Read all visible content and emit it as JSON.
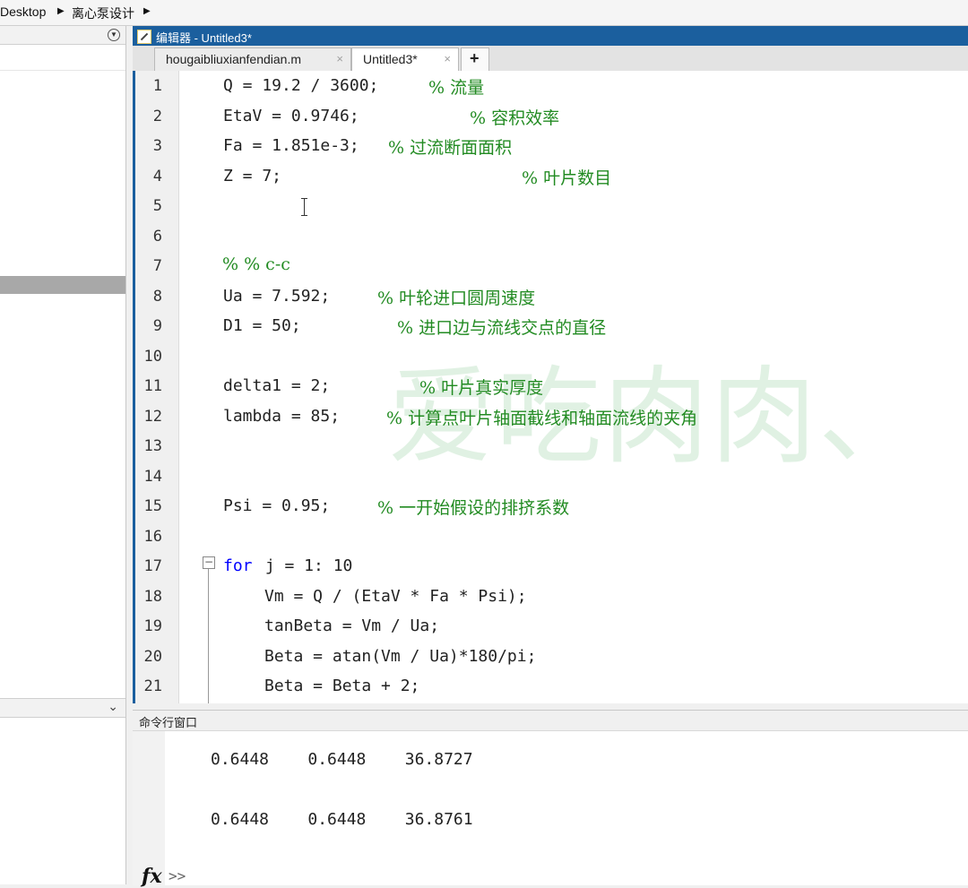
{
  "breadcrumb": [
    "Desktop",
    "离心泵设计"
  ],
  "editor": {
    "title": "编辑器 - Untitled3*",
    "tabs": [
      {
        "label": "hougaibliuxianfendian.m",
        "close": "×"
      },
      {
        "label": "Untitled3*",
        "close": "×"
      }
    ],
    "add_tab": "+",
    "fold_marker": "−",
    "lines": [
      {
        "n": "1",
        "code": "Q = 19.2 / 3600;",
        "comment": "% 流量"
      },
      {
        "n": "2",
        "code": "EtaV = 0.9746;",
        "comment": "% 容积效率"
      },
      {
        "n": "3",
        "code": "Fa = 1.851e-3;",
        "comment": "% 过流断面面积"
      },
      {
        "n": "4",
        "code": "Z = 7;",
        "comment": "% 叶片数目"
      },
      {
        "n": "5",
        "code": "",
        "comment": ""
      },
      {
        "n": "6",
        "code": "",
        "comment": ""
      },
      {
        "n": "7",
        "code": "",
        "comment": "% % c-c"
      },
      {
        "n": "8",
        "code": "Ua = 7.592;",
        "comment": "% 叶轮进口圆周速度"
      },
      {
        "n": "9",
        "code": "D1 = 50;",
        "comment": "% 进口边与流线交点的直径"
      },
      {
        "n": "10",
        "code": "",
        "comment": ""
      },
      {
        "n": "11",
        "code": "delta1 = 2;",
        "comment": "% 叶片真实厚度"
      },
      {
        "n": "12",
        "code": "lambda = 85;",
        "comment": "% 计算点叶片轴面截线和轴面流线的夹角"
      },
      {
        "n": "13",
        "code": "",
        "comment": ""
      },
      {
        "n": "14",
        "code": "",
        "comment": ""
      },
      {
        "n": "15",
        "code": "Psi = 0.95;",
        "comment": "% 一开始假设的排挤系数"
      },
      {
        "n": "16",
        "code": "",
        "comment": ""
      },
      {
        "n": "17",
        "keyword": "for",
        "code": " j = 1: 10",
        "comment": ""
      },
      {
        "n": "18",
        "code": "Vm = Q / (EtaV * Fa * Psi);",
        "comment": ""
      },
      {
        "n": "19",
        "code": "tanBeta = Vm / Ua;",
        "comment": ""
      },
      {
        "n": "20",
        "code": "Beta = atan(Vm / Ua)*180/pi;",
        "comment": ""
      },
      {
        "n": "21",
        "code": "Beta = Beta + 2;",
        "comment": ""
      }
    ],
    "watermark": "爱吃肉肉、"
  },
  "command_window": {
    "title": "命令行窗口",
    "output": [
      "0.6448    0.6448    36.8727",
      "0.6448    0.6448    36.8761"
    ],
    "fx_label": "fx",
    "prompt": ">>"
  }
}
